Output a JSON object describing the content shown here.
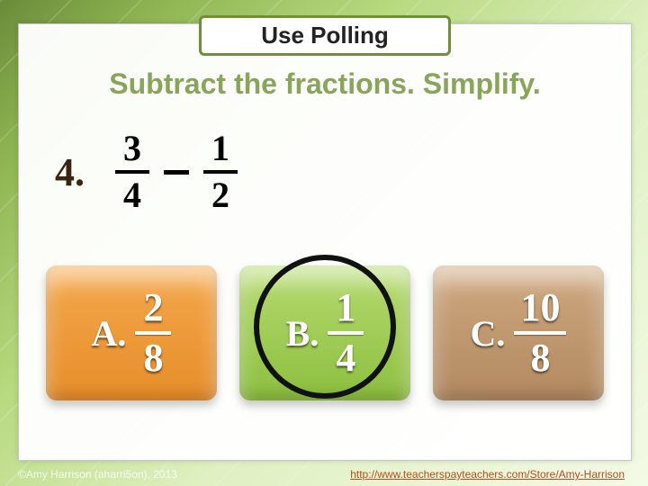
{
  "header": {
    "polling_label": "Use Polling"
  },
  "instruction": "Subtract the fractions.  Simplify.",
  "problem": {
    "number_label": "4.",
    "left": {
      "numerator": "3",
      "denominator": "4"
    },
    "right": {
      "numerator": "1",
      "denominator": "2"
    }
  },
  "answers": [
    {
      "letter": "A.",
      "numerator": "2",
      "denominator": "8",
      "variant": "orange",
      "correct": false
    },
    {
      "letter": "B.",
      "numerator": "1",
      "denominator": "4",
      "variant": "green",
      "correct": true
    },
    {
      "letter": "C.",
      "numerator": "10",
      "denominator": "8",
      "variant": "brown",
      "correct": false
    }
  ],
  "footer": {
    "copyright": "©Amy Harrison (aharri5on), 2013",
    "link_text": "http://www.teacherspayteachers.com/Store/Amy-Harrison"
  }
}
